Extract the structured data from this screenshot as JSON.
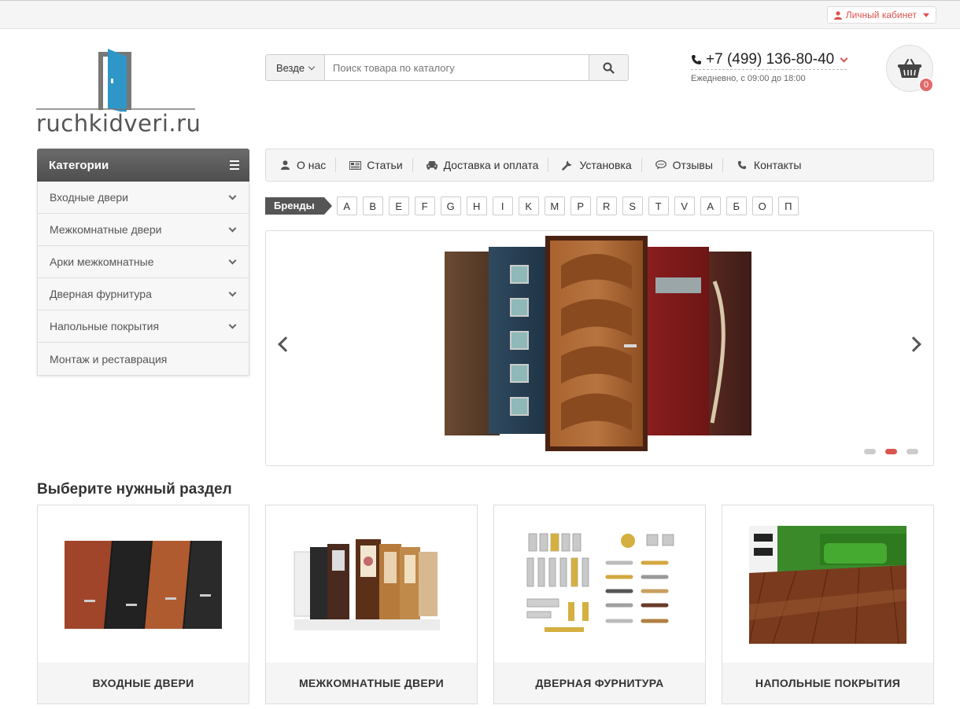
{
  "topbar": {
    "account_label": "Личный кабинет"
  },
  "logo": {
    "text": "ruchkidveri.ru"
  },
  "search": {
    "scope": "Везде",
    "placeholder": "Поиск товара по каталогу",
    "value": ""
  },
  "phone": {
    "number": "+7 (499) 136-80-40",
    "hours": "Ежедневно, с 09:00 до 18:00"
  },
  "cart": {
    "count": "0"
  },
  "categories": {
    "title": "Категории",
    "items": [
      {
        "label": "Входные двери",
        "has_children": true
      },
      {
        "label": "Межкомнатные двери",
        "has_children": true
      },
      {
        "label": "Арки межкомнатные",
        "has_children": true
      },
      {
        "label": "Дверная фурнитура",
        "has_children": true
      },
      {
        "label": "Напольные покрытия",
        "has_children": true
      },
      {
        "label": "Монтаж и реставрация",
        "has_children": false
      }
    ]
  },
  "nav": {
    "items": [
      {
        "label": "О нас",
        "icon": "user-icon"
      },
      {
        "label": "Статьи",
        "icon": "newspaper-icon"
      },
      {
        "label": "Доставка и оплата",
        "icon": "car-icon"
      },
      {
        "label": "Установка",
        "icon": "wrench-icon"
      },
      {
        "label": "Отзывы",
        "icon": "comment-icon"
      },
      {
        "label": "Контакты",
        "icon": "phone-icon"
      }
    ]
  },
  "brands": {
    "label": "Бренды",
    "letters": [
      "A",
      "B",
      "E",
      "F",
      "G",
      "H",
      "I",
      "K",
      "M",
      "P",
      "R",
      "S",
      "T",
      "V",
      "А",
      "Б",
      "О",
      "П"
    ]
  },
  "slider": {
    "slides": 3,
    "active_slide": 2
  },
  "section": {
    "title": "Выберите нужный раздел",
    "cards": [
      {
        "label": "ВХОДНЫЕ ДВЕРИ"
      },
      {
        "label": "МЕЖКОМНАТНЫЕ ДВЕРИ"
      },
      {
        "label": "ДВЕРНАЯ ФУРНИТУРА"
      },
      {
        "label": "НАПОЛЬНЫЕ ПОКРЫТИЯ"
      }
    ]
  },
  "colors": {
    "accent": "#d9534f",
    "header_dark": "#555555"
  }
}
